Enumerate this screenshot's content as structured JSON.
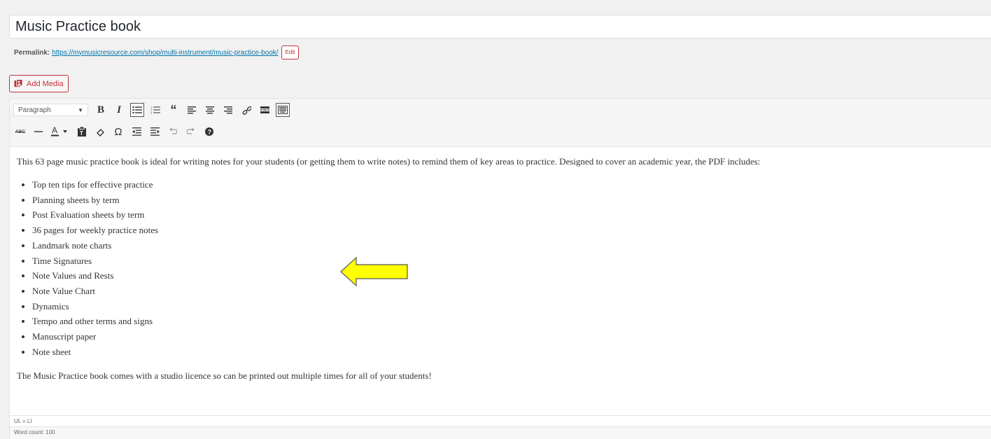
{
  "post": {
    "title": "Music Practice book",
    "permalink_label": "Permalink:",
    "permalink_url": "https://mymusicresource.com/shop/multi-instrument/music-practice-book/",
    "edit_label": "Edit"
  },
  "media": {
    "add_media_label": "Add Media"
  },
  "toolbar": {
    "format_select": "Paragraph",
    "row1": [
      "format-dropdown",
      "bold",
      "italic",
      "bulleted-list",
      "numbered-list",
      "blockquote",
      "align-left",
      "align-center",
      "align-right",
      "insert-link",
      "read-more",
      "toolbar-toggle"
    ],
    "row2": [
      "strikethrough",
      "horizontal-line",
      "text-color",
      "paste-as-text",
      "clear-formatting",
      "special-character",
      "decrease-indent",
      "increase-indent",
      "undo",
      "redo",
      "help"
    ]
  },
  "content": {
    "intro": "This 63 page music practice book is ideal for writing notes for your students (or getting them to write notes) to remind them of key areas to practice.  Designed to cover an academic year, the PDF includes:",
    "items": [
      "Top ten tips for effective practice",
      "Planning sheets by term",
      "Post Evaluation sheets by term",
      "36 pages for weekly practice notes",
      "Landmark note charts",
      "Time Signatures",
      "Note Values and Rests",
      "Note Value Chart",
      "Dynamics",
      "Tempo and other terms and signs",
      "Manuscript paper",
      "Note sheet"
    ],
    "outro": "The Music Practice book comes with a studio licence so can be printed out multiple times for all of your students!"
  },
  "status": {
    "element_path": "UL » LI",
    "word_count": "Word count: 100"
  },
  "colors": {
    "accent": "#c3333a",
    "link": "#0073aa",
    "arrow_fill": "#ffff00"
  }
}
